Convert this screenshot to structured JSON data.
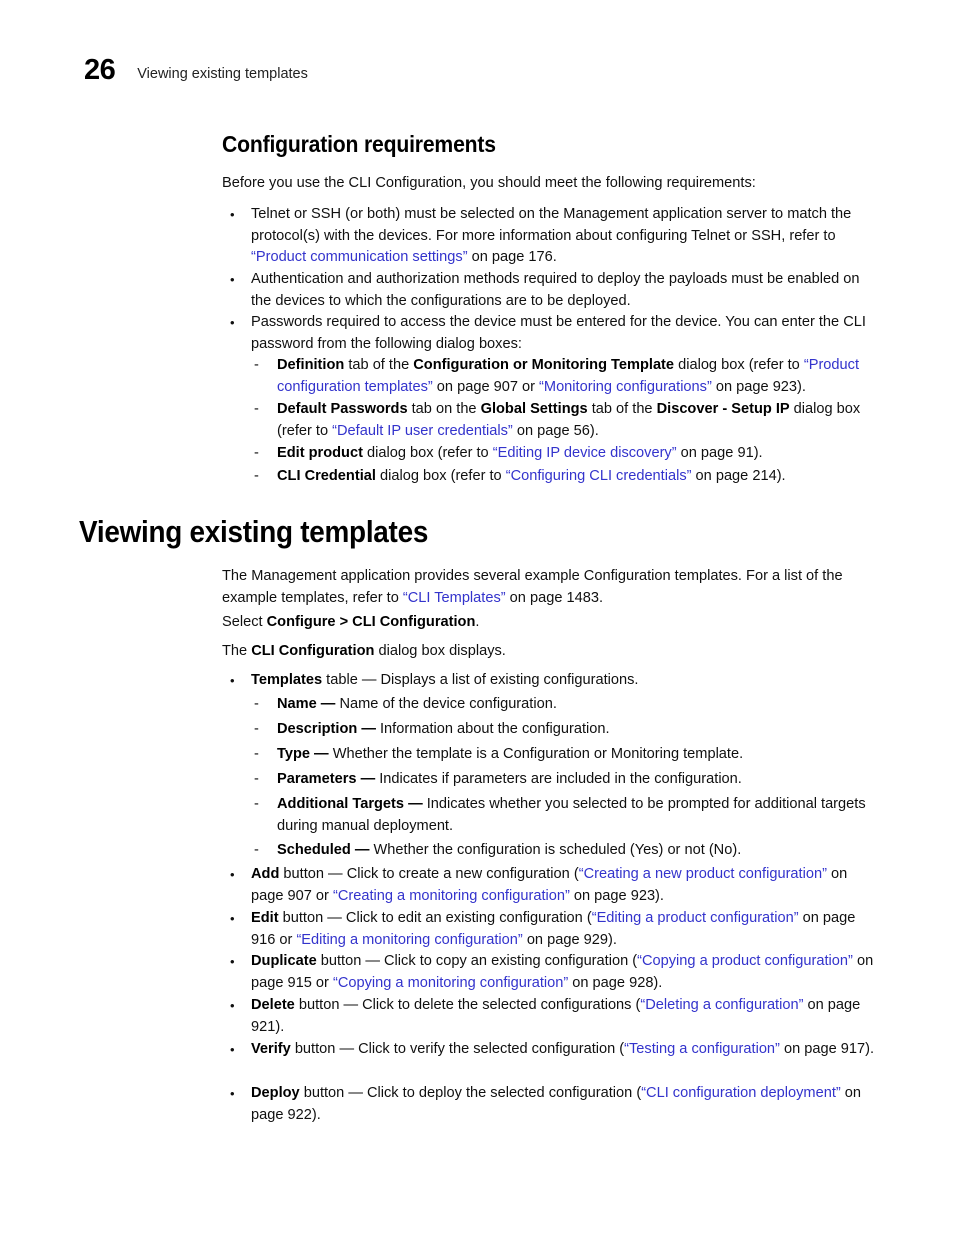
{
  "header": {
    "page_number": "26",
    "title": "Viewing existing templates"
  },
  "colors": {
    "link": "#3333CC",
    "text": "#101010",
    "background": "#FFFFFF"
  },
  "sections": {
    "config_requirements": {
      "heading": "Configuration requirements",
      "intro": "Before you use the CLI Configuration, you should meet the following requirements:",
      "bullets": [
        {
          "marker": "•",
          "parts": [
            {
              "t": "Telnet or SSH (or both) must be selected on the Management application server to match the protocol(s) with the devices. For more information about configuring Telnet or SSH, refer to ",
              "s": "normal"
            },
            {
              "t": "“Product communication settings”",
              "s": "link"
            },
            {
              "t": " on page 176.",
              "s": "normal"
            }
          ]
        },
        {
          "marker": "•",
          "parts": [
            {
              "t": "Authentication and authorization methods required to deploy the payloads must be enabled on the devices to which the configurations are to be deployed.",
              "s": "normal"
            }
          ]
        },
        {
          "marker": "•",
          "parts": [
            {
              "t": "Passwords required to access the device must be entered for the device. You can enter the CLI password from the following dialog boxes:",
              "s": "normal"
            }
          ]
        }
      ],
      "subitems": [
        {
          "marker": "-",
          "parts": [
            {
              "t": "Definition",
              "s": "bold"
            },
            {
              "t": " tab of the ",
              "s": "normal"
            },
            {
              "t": "Configuration or Monitoring Template",
              "s": "bold"
            },
            {
              "t": " dialog box (refer to ",
              "s": "normal"
            },
            {
              "t": "“Product configuration templates”",
              "s": "link"
            },
            {
              "t": " on page 907 or ",
              "s": "normal"
            },
            {
              "t": "“Monitoring configurations”",
              "s": "link"
            },
            {
              "t": " on page 923).",
              "s": "normal"
            }
          ]
        },
        {
          "marker": "-",
          "parts": [
            {
              "t": "Default Passwords",
              "s": "bold"
            },
            {
              "t": " tab on the ",
              "s": "normal"
            },
            {
              "t": "Global Settings",
              "s": "bold"
            },
            {
              "t": " tab of the ",
              "s": "normal"
            },
            {
              "t": "Discover - Setup IP",
              "s": "bold"
            },
            {
              "t": " dialog box (refer to ",
              "s": "normal"
            },
            {
              "t": "“Default IP user credentials”",
              "s": "link"
            },
            {
              "t": " on page 56).",
              "s": "normal"
            }
          ]
        },
        {
          "marker": "-",
          "parts": [
            {
              "t": "Edit product",
              "s": "bold"
            },
            {
              "t": " dialog box (refer to ",
              "s": "normal"
            },
            {
              "t": "“Editing IP device discovery”",
              "s": "link"
            },
            {
              "t": " on page 91).",
              "s": "normal"
            }
          ]
        },
        {
          "marker": "-",
          "parts": [
            {
              "t": "CLI Credential",
              "s": "bold"
            },
            {
              "t": " dialog box (refer to ",
              "s": "normal"
            },
            {
              "t": "“Configuring CLI credentials”",
              "s": "link"
            },
            {
              "t": " on page 214).",
              "s": "normal"
            }
          ]
        }
      ]
    },
    "viewing_existing_templates": {
      "heading": "Viewing existing templates",
      "paragraphs": [
        {
          "parts": [
            {
              "t": "The Management application provides several example Configuration templates. For a list of the example templates, refer to ",
              "s": "normal"
            },
            {
              "t": "“CLI Templates”",
              "s": "link"
            },
            {
              "t": " on page 1483.",
              "s": "normal"
            }
          ]
        },
        {
          "parts": [
            {
              "t": "Select ",
              "s": "normal"
            },
            {
              "t": "Configure > CLI Configuration",
              "s": "bold"
            },
            {
              "t": ".",
              "s": "normal"
            }
          ]
        },
        {
          "parts": [
            {
              "t": "The ",
              "s": "normal"
            },
            {
              "t": "CLI Configuration",
              "s": "bold"
            },
            {
              "t": " dialog box displays.",
              "s": "normal"
            }
          ]
        }
      ],
      "templates_bullet": {
        "marker": "•",
        "parts": [
          {
            "t": "Templates",
            "s": "bold"
          },
          {
            "t": " table — Displays a list of existing configurations.",
            "s": "normal"
          }
        ]
      },
      "table_columns": [
        {
          "marker": "-",
          "parts": [
            {
              "t": "Name —",
              "s": "bold"
            },
            {
              "t": " Name of the device configuration.",
              "s": "normal"
            }
          ]
        },
        {
          "marker": "-",
          "parts": [
            {
              "t": "Description —",
              "s": "bold"
            },
            {
              "t": " Information about the configuration.",
              "s": "normal"
            }
          ]
        },
        {
          "marker": "-",
          "parts": [
            {
              "t": "Type —",
              "s": "bold"
            },
            {
              "t": " Whether the template is a Configuration or Monitoring template.",
              "s": "normal"
            }
          ]
        },
        {
          "marker": "-",
          "parts": [
            {
              "t": "Parameters —",
              "s": "bold"
            },
            {
              "t": " Indicates if parameters are included in the configuration.",
              "s": "normal"
            }
          ]
        },
        {
          "marker": "-",
          "parts": [
            {
              "t": "Additional Targets —",
              "s": "bold"
            },
            {
              "t": " Indicates whether you selected to be prompted for additional targets during manual deployment.",
              "s": "normal"
            }
          ]
        },
        {
          "marker": "-",
          "parts": [
            {
              "t": "Scheduled —",
              "s": "bold"
            },
            {
              "t": " Whether the configuration is scheduled (Yes) or not (No).",
              "s": "normal"
            }
          ]
        }
      ],
      "buttons": [
        {
          "marker": "•",
          "parts": [
            {
              "t": "Add",
              "s": "bold"
            },
            {
              "t": " button — Click to create a new configuration (",
              "s": "normal"
            },
            {
              "t": "“Creating a new product configuration”",
              "s": "link"
            },
            {
              "t": " on page 907 or ",
              "s": "normal"
            },
            {
              "t": "“Creating a monitoring configuration”",
              "s": "link"
            },
            {
              "t": " on page 923).",
              "s": "normal"
            }
          ]
        },
        {
          "marker": "•",
          "parts": [
            {
              "t": "Edit",
              "s": "bold"
            },
            {
              "t": " button — Click to edit an existing configuration (",
              "s": "normal"
            },
            {
              "t": "“Editing a product configuration”",
              "s": "link"
            },
            {
              "t": " on page 916 or ",
              "s": "normal"
            },
            {
              "t": "“Editing a monitoring configuration”",
              "s": "link"
            },
            {
              "t": " on page 929).",
              "s": "normal"
            }
          ]
        },
        {
          "marker": "•",
          "parts": [
            {
              "t": "Duplicate",
              "s": "bold"
            },
            {
              "t": " button — Click to copy an existing configuration (",
              "s": "normal"
            },
            {
              "t": "“Copying a product configuration”",
              "s": "link"
            },
            {
              "t": " on page 915 or ",
              "s": "normal"
            },
            {
              "t": "“Copying a monitoring configuration”",
              "s": "link"
            },
            {
              "t": " on page 928).",
              "s": "normal"
            }
          ]
        },
        {
          "marker": "•",
          "parts": [
            {
              "t": "Delete",
              "s": "bold"
            },
            {
              "t": " button — Click to delete the selected configurations (",
              "s": "normal"
            },
            {
              "t": "“Deleting a configuration”",
              "s": "link"
            },
            {
              "t": " on page 921).",
              "s": "normal"
            }
          ]
        },
        {
          "marker": "•",
          "parts": [
            {
              "t": "Verify",
              "s": "bold"
            },
            {
              "t": " button — Click to verify the selected configuration (",
              "s": "normal"
            },
            {
              "t": "“Testing a configuration”",
              "s": "link"
            },
            {
              "t": " on page 917).",
              "s": "normal"
            }
          ]
        },
        {
          "marker": "•",
          "parts": [
            {
              "t": "Deploy",
              "s": "bold"
            },
            {
              "t": " button — Click to deploy the selected configuration (",
              "s": "normal"
            },
            {
              "t": "“CLI configuration deployment”",
              "s": "link"
            },
            {
              "t": " on page 922).",
              "s": "normal"
            }
          ]
        }
      ]
    }
  }
}
